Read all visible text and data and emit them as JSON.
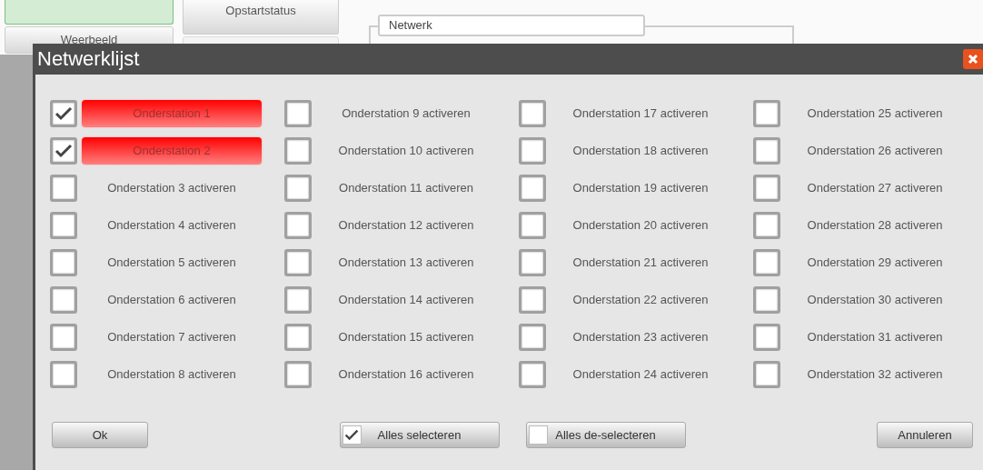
{
  "background": {
    "tabs": [
      {
        "label": "Weerbeeld"
      },
      {
        "label": "Opstartstatus"
      }
    ],
    "fieldset": {
      "legend": "Netwerk"
    }
  },
  "dialog": {
    "title": "Netwerklijst",
    "stations": [
      {
        "label": "Onderstation 1",
        "checked": true
      },
      {
        "label": "Onderstation 2",
        "checked": true
      },
      {
        "label": "Onderstation 3 activeren",
        "checked": false
      },
      {
        "label": "Onderstation 4 activeren",
        "checked": false
      },
      {
        "label": "Onderstation 5 activeren",
        "checked": false
      },
      {
        "label": "Onderstation 6 activeren",
        "checked": false
      },
      {
        "label": "Onderstation 7 activeren",
        "checked": false
      },
      {
        "label": "Onderstation 8 activeren",
        "checked": false
      },
      {
        "label": "Onderstation 9 activeren",
        "checked": false
      },
      {
        "label": "Onderstation 10 activeren",
        "checked": false
      },
      {
        "label": "Onderstation 11 activeren",
        "checked": false
      },
      {
        "label": "Onderstation 12 activeren",
        "checked": false
      },
      {
        "label": "Onderstation 13 activeren",
        "checked": false
      },
      {
        "label": "Onderstation 14 activeren",
        "checked": false
      },
      {
        "label": "Onderstation 15 activeren",
        "checked": false
      },
      {
        "label": "Onderstation 16 activeren",
        "checked": false
      },
      {
        "label": "Onderstation 17 activeren",
        "checked": false
      },
      {
        "label": "Onderstation 18 activeren",
        "checked": false
      },
      {
        "label": "Onderstation 19 activeren",
        "checked": false
      },
      {
        "label": "Onderstation 20 activeren",
        "checked": false
      },
      {
        "label": "Onderstation 21 activeren",
        "checked": false
      },
      {
        "label": "Onderstation 22 activeren",
        "checked": false
      },
      {
        "label": "Onderstation 23 activeren",
        "checked": false
      },
      {
        "label": "Onderstation 24 activeren",
        "checked": false
      },
      {
        "label": "Onderstation 25 activeren",
        "checked": false
      },
      {
        "label": "Onderstation 26 activeren",
        "checked": false
      },
      {
        "label": "Onderstation 27 activeren",
        "checked": false
      },
      {
        "label": "Onderstation 28 activeren",
        "checked": false
      },
      {
        "label": "Onderstation 29 activeren",
        "checked": false
      },
      {
        "label": "Onderstation 30 activeren",
        "checked": false
      },
      {
        "label": "Onderstation 31 activeren",
        "checked": false
      },
      {
        "label": "Onderstation 32 activeren",
        "checked": false
      }
    ],
    "buttons": [
      {
        "kind": "plain",
        "label": "Ok"
      },
      {
        "kind": "check",
        "label": "Alles selecteren",
        "checked": true
      },
      {
        "kind": "check",
        "label": "Alles de-selecteren",
        "checked": false
      },
      {
        "kind": "plain",
        "label": "Annuleren"
      }
    ]
  }
}
